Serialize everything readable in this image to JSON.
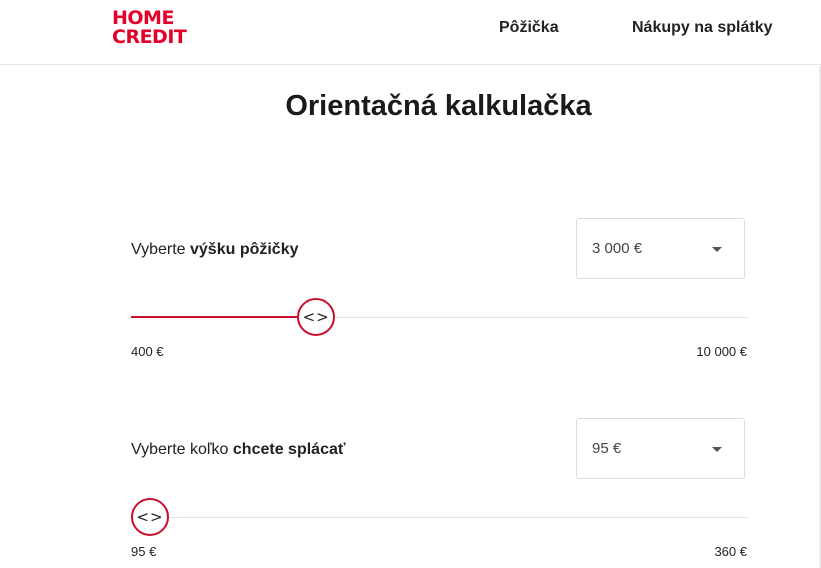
{
  "header": {
    "logo_line1": "HOME",
    "logo_line2": "CREDIT",
    "nav": [
      {
        "label": "Pôžička"
      },
      {
        "label": "Nákupy na splátky"
      }
    ]
  },
  "main": {
    "title": "Orientačná kalkulačka"
  },
  "loan_amount": {
    "label_prefix": "Vyberte",
    "label_bold": "výšku pôžičky",
    "selected_value": "3 000 €",
    "min_label": "400 €",
    "max_label": "10 000 €",
    "slider_fraction": 0.2875
  },
  "repayment": {
    "label_prefix": "Vyberte koľko",
    "label_bold": "chcete splácať",
    "selected_value": "95 €",
    "min_label": "95 €",
    "max_label": "360 €",
    "slider_fraction": 0.0
  },
  "colors": {
    "brand": "#e4002b",
    "accent": "#c8102e"
  },
  "icons": {
    "slider_handle": "chevron-left-right-icon",
    "dropdown": "caret-down-icon"
  }
}
